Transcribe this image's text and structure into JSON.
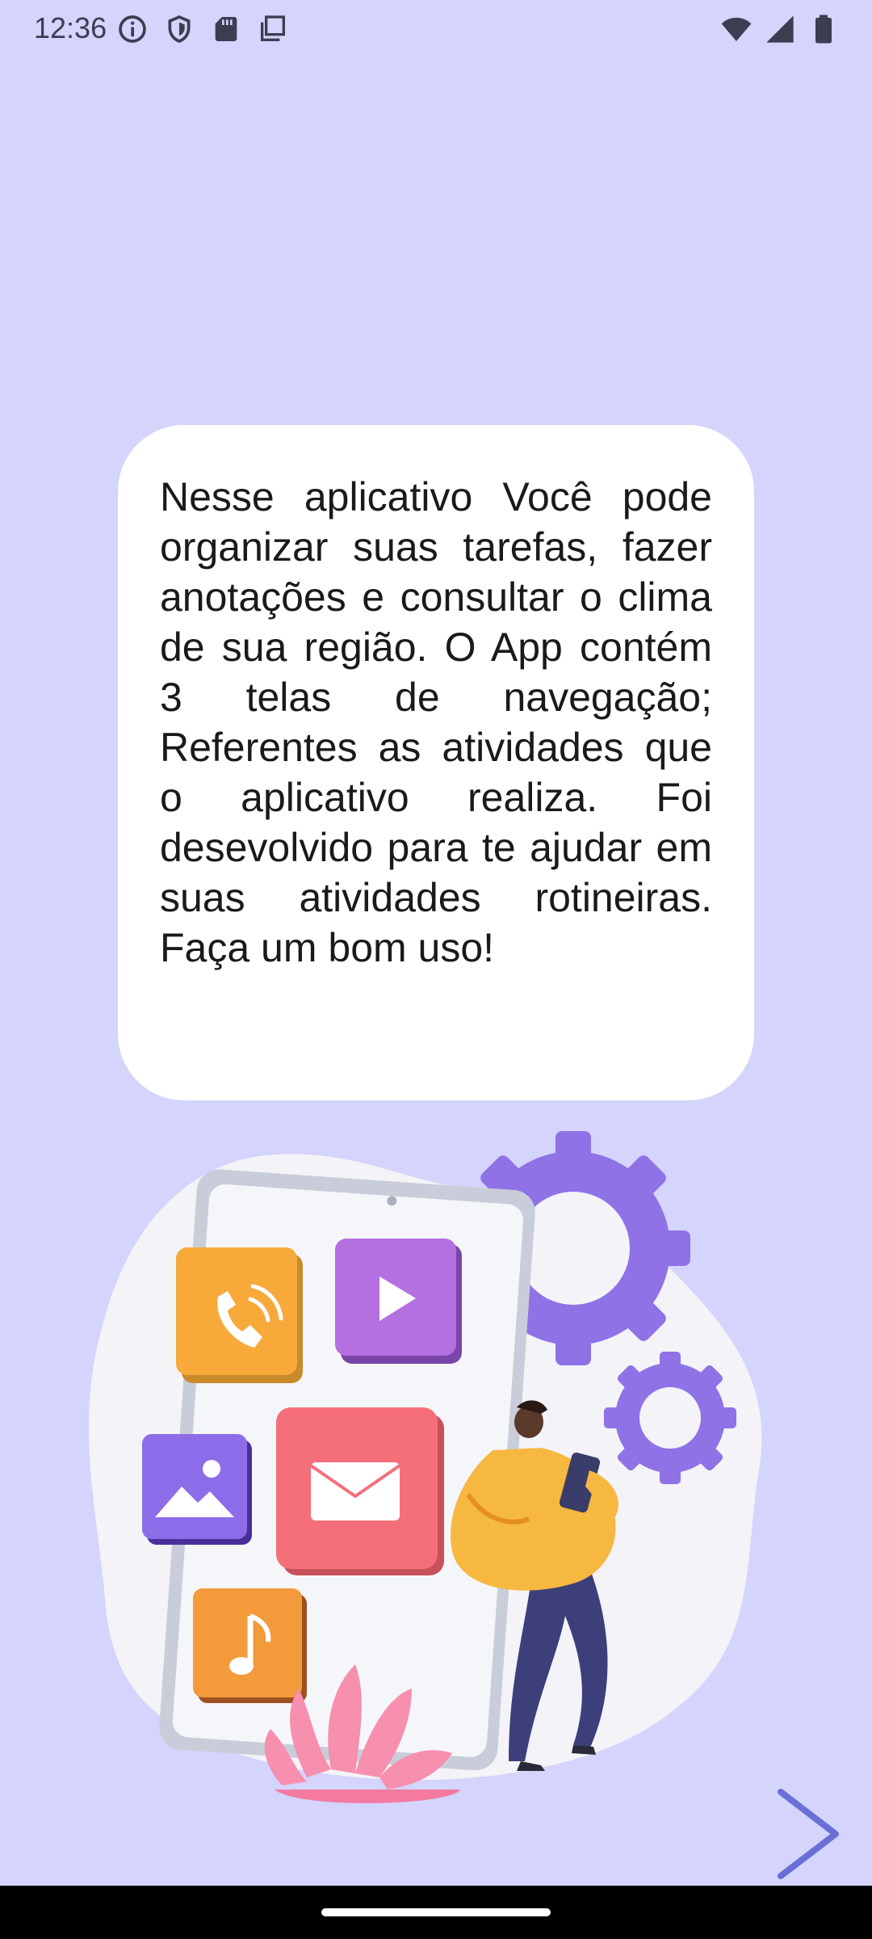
{
  "status_bar": {
    "time": "12:36",
    "left_icons": [
      "info-icon",
      "shield-icon",
      "sd-card-icon",
      "copy-icon"
    ],
    "right_icons": [
      "wifi-icon",
      "signal-icon",
      "battery-icon"
    ]
  },
  "intro": {
    "description": "Nesse aplicativo Você pode organizar suas tarefas, fazer anotações e consultar o clima de sua região. O App contém 3 telas de navegação; Referentes as atividades que o aplicativo realiza. Foi desevolvido para te ajudar em suas atividades rotineiras. Faça um bom uso!"
  },
  "illustration": {
    "icons": [
      "phone-call-icon",
      "play-icon",
      "image-icon",
      "mail-icon",
      "music-note-icon",
      "gear-icon",
      "person-with-phone",
      "coral-plant"
    ]
  },
  "navigation": {
    "next_icon": "chevron-right-icon"
  },
  "colors": {
    "background": "#d4d4fc",
    "card": "#ffffff",
    "accent": "#6a6fd6",
    "gear": "#8f72e6",
    "tile_orange": "#f7a93a",
    "tile_purple": "#b46fe0",
    "tile_red": "#f46f7a"
  }
}
